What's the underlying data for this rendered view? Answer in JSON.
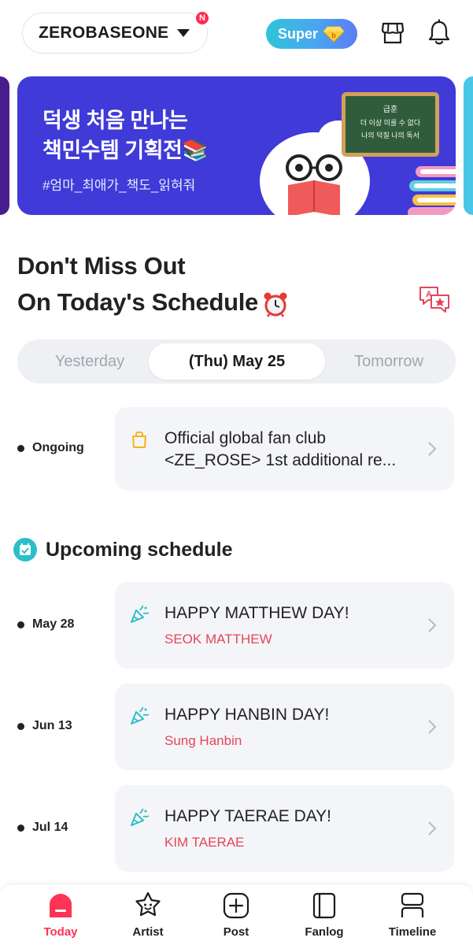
{
  "header": {
    "group_name": "ZEROBASEONE",
    "notification_badge": "N",
    "super_label": "Super",
    "colors": {
      "badge": "#ff2a4d",
      "super_start": "#2fc4d9",
      "super_end": "#5b7cf5"
    }
  },
  "banner": {
    "line1": "덕생 처음 만나는",
    "line2": "책민수템 기획전📚",
    "hashtag": "#엄마_최애가_책도_읽혀줘",
    "chalk_line1": "급훈",
    "chalk_line2": "더 이상 미룰 수 없다",
    "chalk_line3": "나의 덕질 나의 독서",
    "color": "#3f3ad8"
  },
  "schedule": {
    "title_line1": "Don't Miss Out",
    "title_line2": "On Today's Schedule",
    "tabs": {
      "yesterday": "Yesterday",
      "today": "(Thu) May 25",
      "tomorrow": "Tomorrow"
    },
    "ongoing": {
      "label": "Ongoing",
      "title_line1": "Official global fan club",
      "title_line2": "<ZE_ROSE> 1st additional re..."
    },
    "upcoming_heading": "Upcoming schedule",
    "upcoming": [
      {
        "date": "May 28",
        "title": "HAPPY MATTHEW DAY!",
        "member": "SEOK MATTHEW"
      },
      {
        "date": "Jun 13",
        "title": "HAPPY HANBIN DAY!",
        "member": "Sung Hanbin"
      },
      {
        "date": "Jul 14",
        "title": "HAPPY TAERAE DAY!",
        "member": "KIM TAERAE"
      }
    ],
    "colors": {
      "member_text": "#e5455b",
      "party_icon": "#2bbfc9",
      "bag_icon": "#f2b619"
    }
  },
  "bottom_nav": {
    "items": [
      {
        "label": "Today",
        "icon": "home-icon",
        "active": true
      },
      {
        "label": "Artist",
        "icon": "star-face-icon",
        "active": false
      },
      {
        "label": "Post",
        "icon": "plus-square-icon",
        "active": false
      },
      {
        "label": "Fanlog",
        "icon": "book-icon",
        "active": false
      },
      {
        "label": "Timeline",
        "icon": "timeline-icon",
        "active": false
      }
    ],
    "active_color": "#ff3355"
  }
}
